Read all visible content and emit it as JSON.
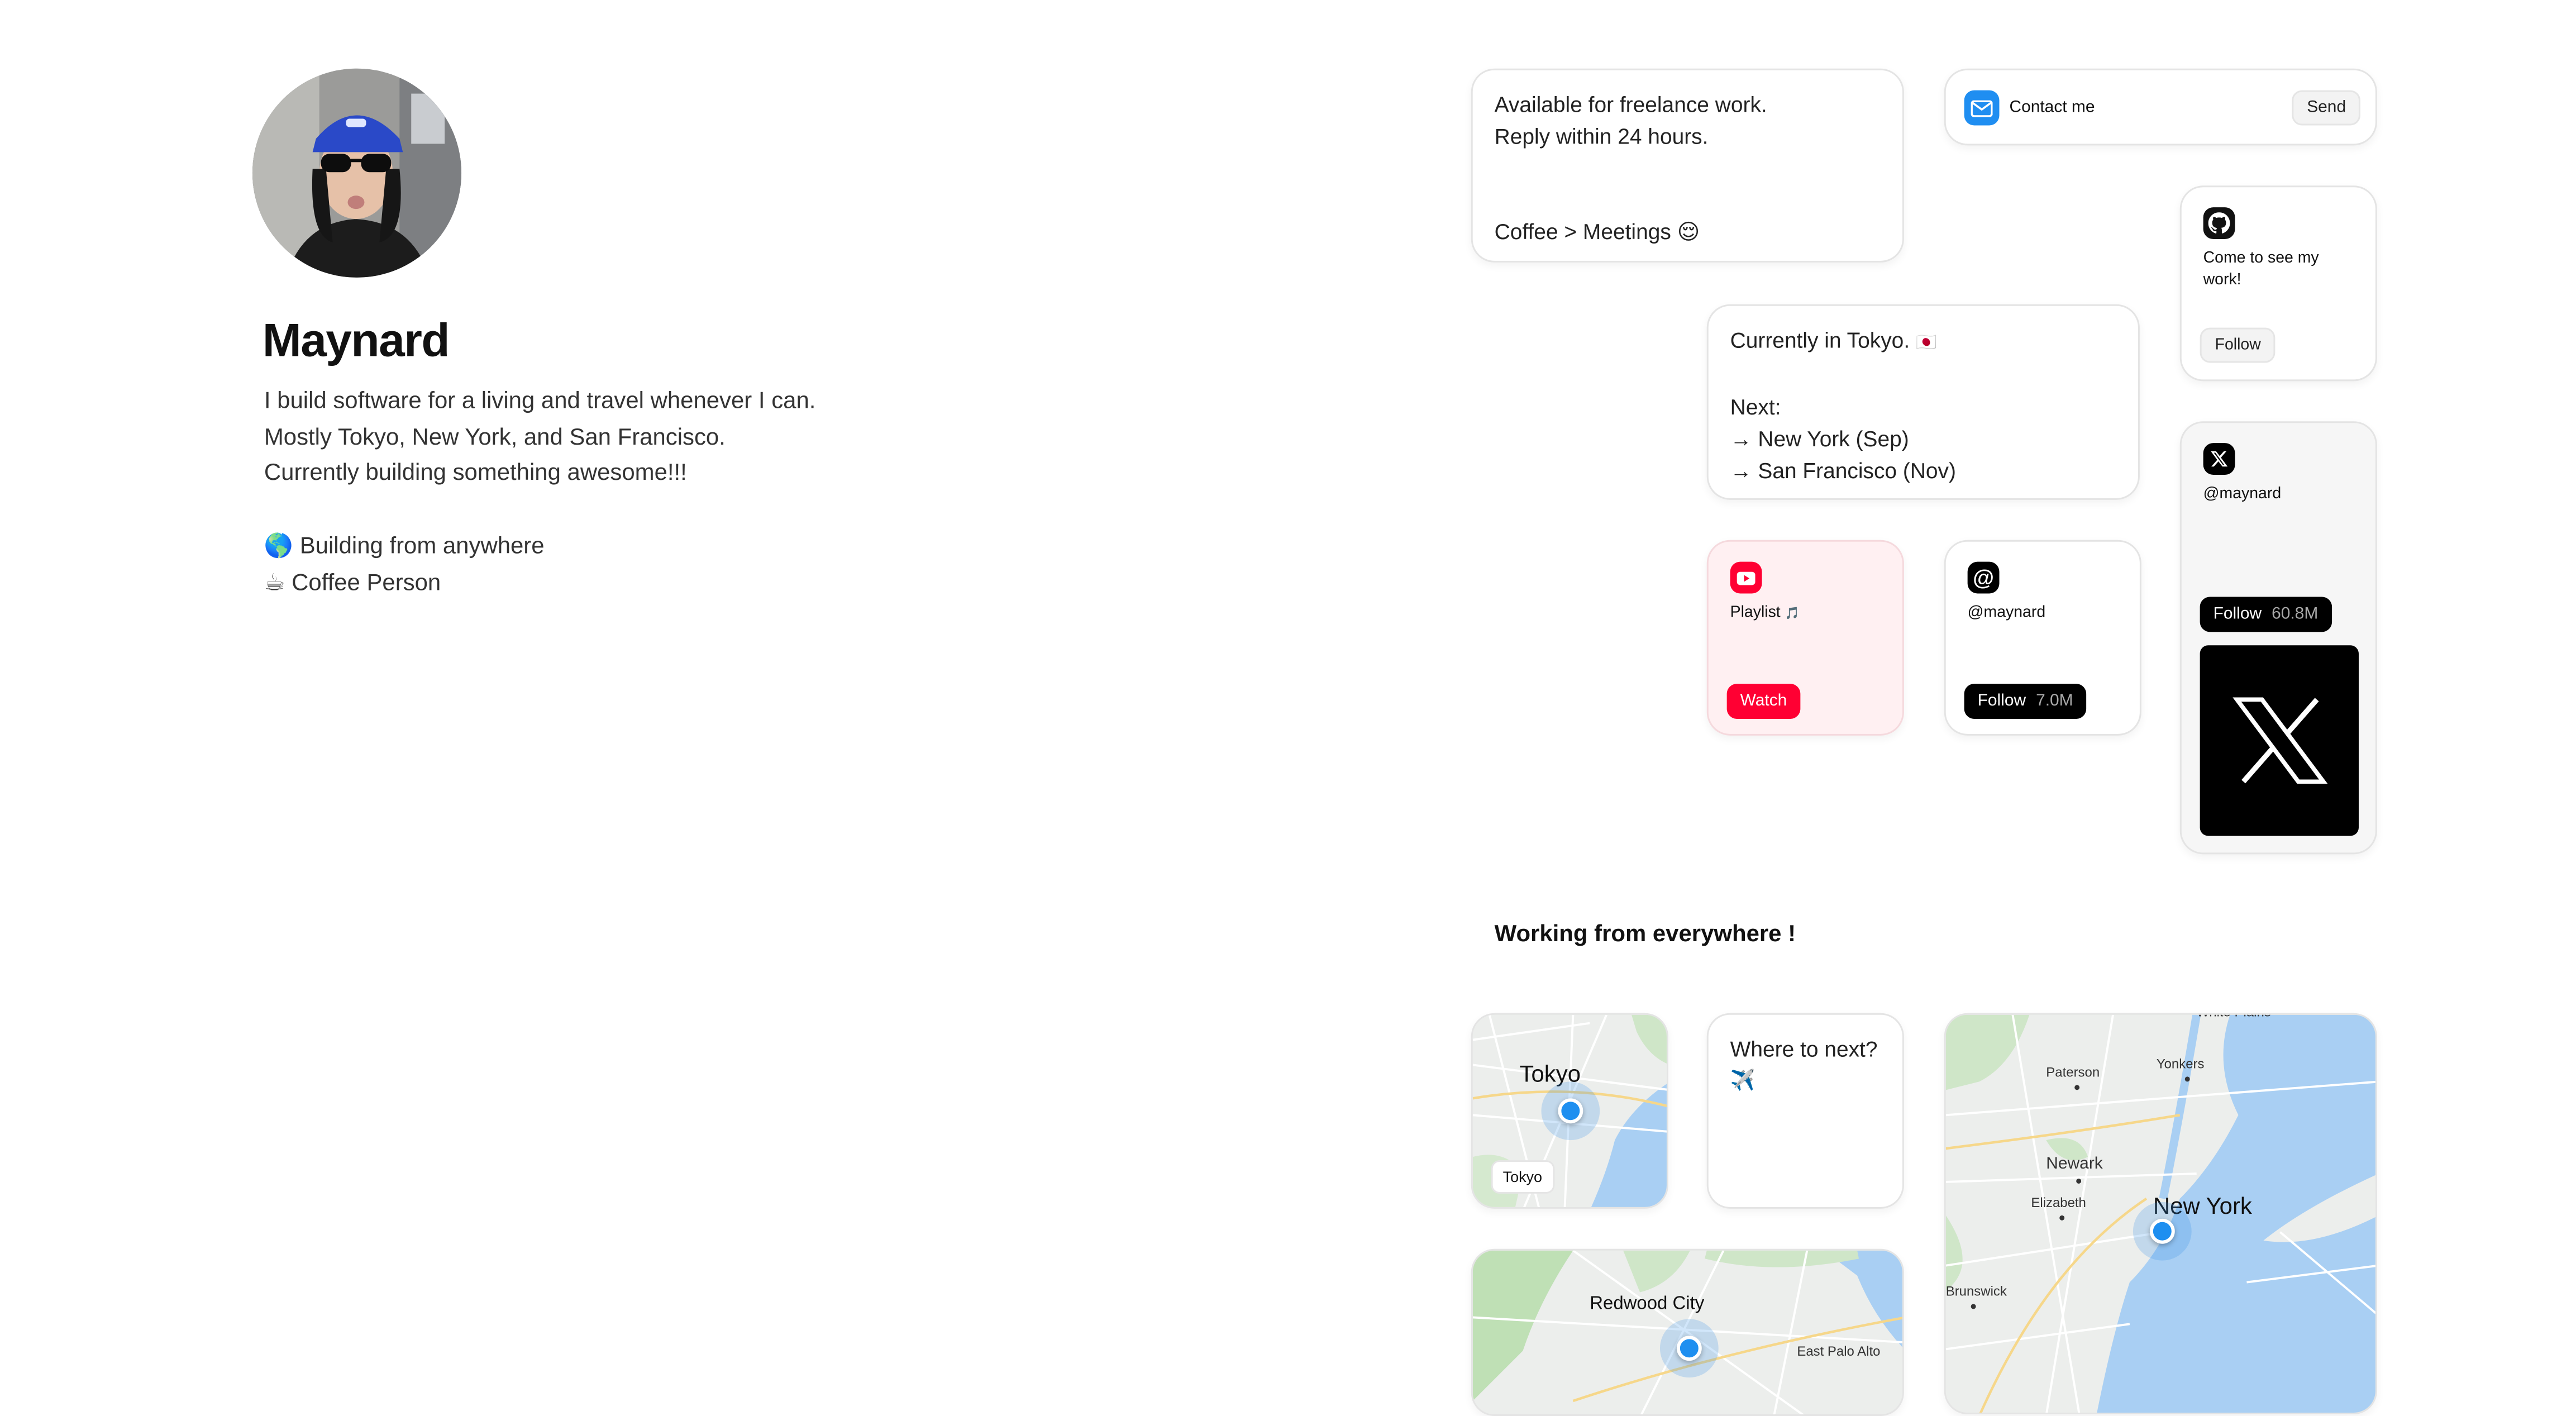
{
  "profile": {
    "name": "Maynard",
    "bio": [
      "I build software for a living and travel whenever I can.",
      "Mostly Tokyo, New York, and San Francisco.",
      "Currently building something awesome!!!"
    ],
    "traits": [
      {
        "emoji": "🌎",
        "label": "Building from anywhere"
      },
      {
        "emoji": "☕",
        "label": "Coffee Person"
      }
    ]
  },
  "availability": {
    "line1": "Available for freelance work.",
    "line2": "Reply within 24 hours.",
    "line3": "Coffee > Meetings",
    "emoji": "😌"
  },
  "contact": {
    "label": "Contact me",
    "button": "Send",
    "icon": "mail-icon"
  },
  "github": {
    "text": "Come to see my work!",
    "button": "Follow",
    "icon": "github-icon"
  },
  "location": {
    "current": "Currently in Tokyo.",
    "flag": "🇯🇵",
    "next_label": "Next:",
    "next": [
      "→ New York (Sep)",
      "→ San Francisco (Nov)"
    ]
  },
  "youtube": {
    "label": "Playlist",
    "emoji": "🎵",
    "button": "Watch",
    "icon": "youtube-icon"
  },
  "threads": {
    "handle": "@maynard",
    "button": "Follow",
    "count": "7.0M",
    "icon": "threads-icon"
  },
  "x": {
    "handle": "@maynard",
    "button": "Follow",
    "count": "60.8M",
    "icon": "x-icon"
  },
  "section_title": "Working from everywhere !",
  "maps": {
    "tokyo": {
      "title": "Tokyo",
      "chip": "Tokyo"
    },
    "next": {
      "text": "Where to next?",
      "emoji": "✈️"
    },
    "newyork": {
      "title": "New York",
      "labels": [
        "White Plains",
        "Paterson",
        "Yonkers",
        "Newark",
        "Elizabeth",
        "Brunswick"
      ]
    },
    "sf": {
      "title": "Redwood City",
      "labels": [
        "East Palo Alto"
      ]
    }
  }
}
